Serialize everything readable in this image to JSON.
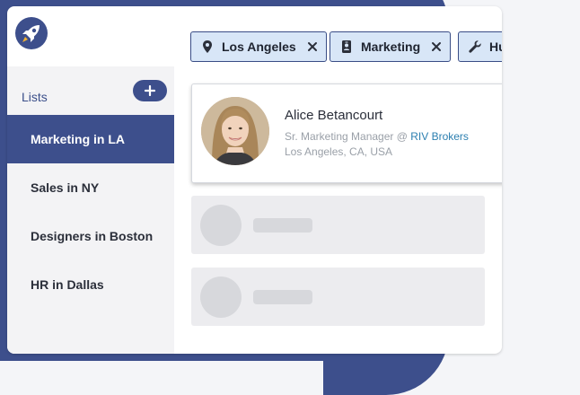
{
  "app": {
    "logo_icon": "rocket-icon",
    "accent_color": "#3d4f8c"
  },
  "sidebar": {
    "header_label": "Lists",
    "add_icon": "plus-icon",
    "items": [
      {
        "label": "Marketing in LA",
        "active": true
      },
      {
        "label": "Sales in NY",
        "active": false
      },
      {
        "label": "Designers in Boston",
        "active": false
      },
      {
        "label": "HR in Dallas",
        "active": false
      }
    ]
  },
  "filters": [
    {
      "label": "Los Angeles",
      "icon": "location-pin-icon"
    },
    {
      "label": "Marketing",
      "icon": "id-badge-icon"
    },
    {
      "label": "HubSpot",
      "icon": "wrench-icon"
    }
  ],
  "profile": {
    "name": "Alice Betancourt",
    "title": "Sr. Marketing Manager @",
    "company": "RIV Brokers",
    "location": "Los Angeles, CA, USA"
  }
}
